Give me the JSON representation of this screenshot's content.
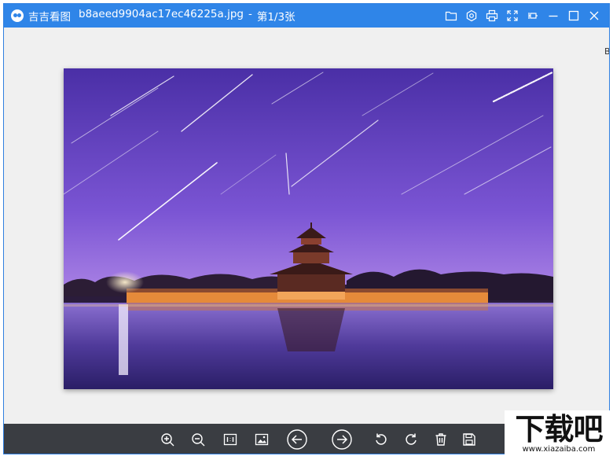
{
  "window": {
    "app_name": "吉吉看图",
    "file_name": "b8aeed9904ac17ec46225a.jpg",
    "separator": "-",
    "page_indicator": "第1/3张"
  },
  "titlebar_icons": [
    "folder-icon",
    "settings-icon",
    "print-icon",
    "fullscreen-icon",
    "pin-icon",
    "minimize-icon",
    "maximize-icon",
    "close-icon"
  ],
  "stage": {
    "edge_text": "B"
  },
  "toolbar": {
    "buttons": [
      "zoom-in",
      "zoom-out",
      "actual-size",
      "fit-image",
      "previous",
      "next",
      "rotate-left",
      "rotate-right",
      "delete",
      "save"
    ]
  },
  "watermark": {
    "logo_text": "下载吧",
    "url": "www.xiazaiba.com"
  },
  "colors": {
    "titlebar": "#2f85e8",
    "toolbar": "#3a3d42",
    "stage": "#f0f0f0"
  }
}
